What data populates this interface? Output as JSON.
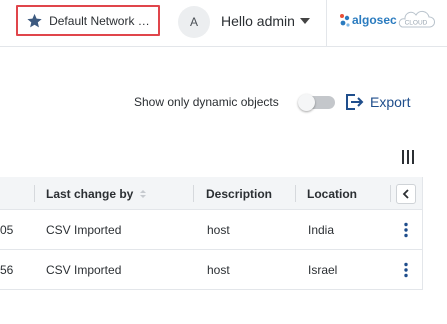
{
  "header": {
    "favorite_label": "Default Network Ob...",
    "avatar_initial": "A",
    "greeting": "Hello admin",
    "logo_text": "algosec",
    "logo_cloud_text": "CLOUD"
  },
  "toolbar": {
    "dynamic_toggle_label": "Show only dynamic objects",
    "dynamic_toggle_on": false,
    "export_label": "Export"
  },
  "table": {
    "columns": [
      "Last change by",
      "Description",
      "Location"
    ],
    "rows": [
      {
        "prev_fragment": "05",
        "last_change_by": "CSV Imported",
        "description": "host",
        "location": "India"
      },
      {
        "prev_fragment": "56",
        "last_change_by": "CSV Imported",
        "description": "host",
        "location": "Israel"
      }
    ]
  },
  "colors": {
    "accent": "#1f4e8c",
    "star": "#3d5a80",
    "highlight_border": "#e0454b",
    "logo": "#2a7bbf"
  }
}
